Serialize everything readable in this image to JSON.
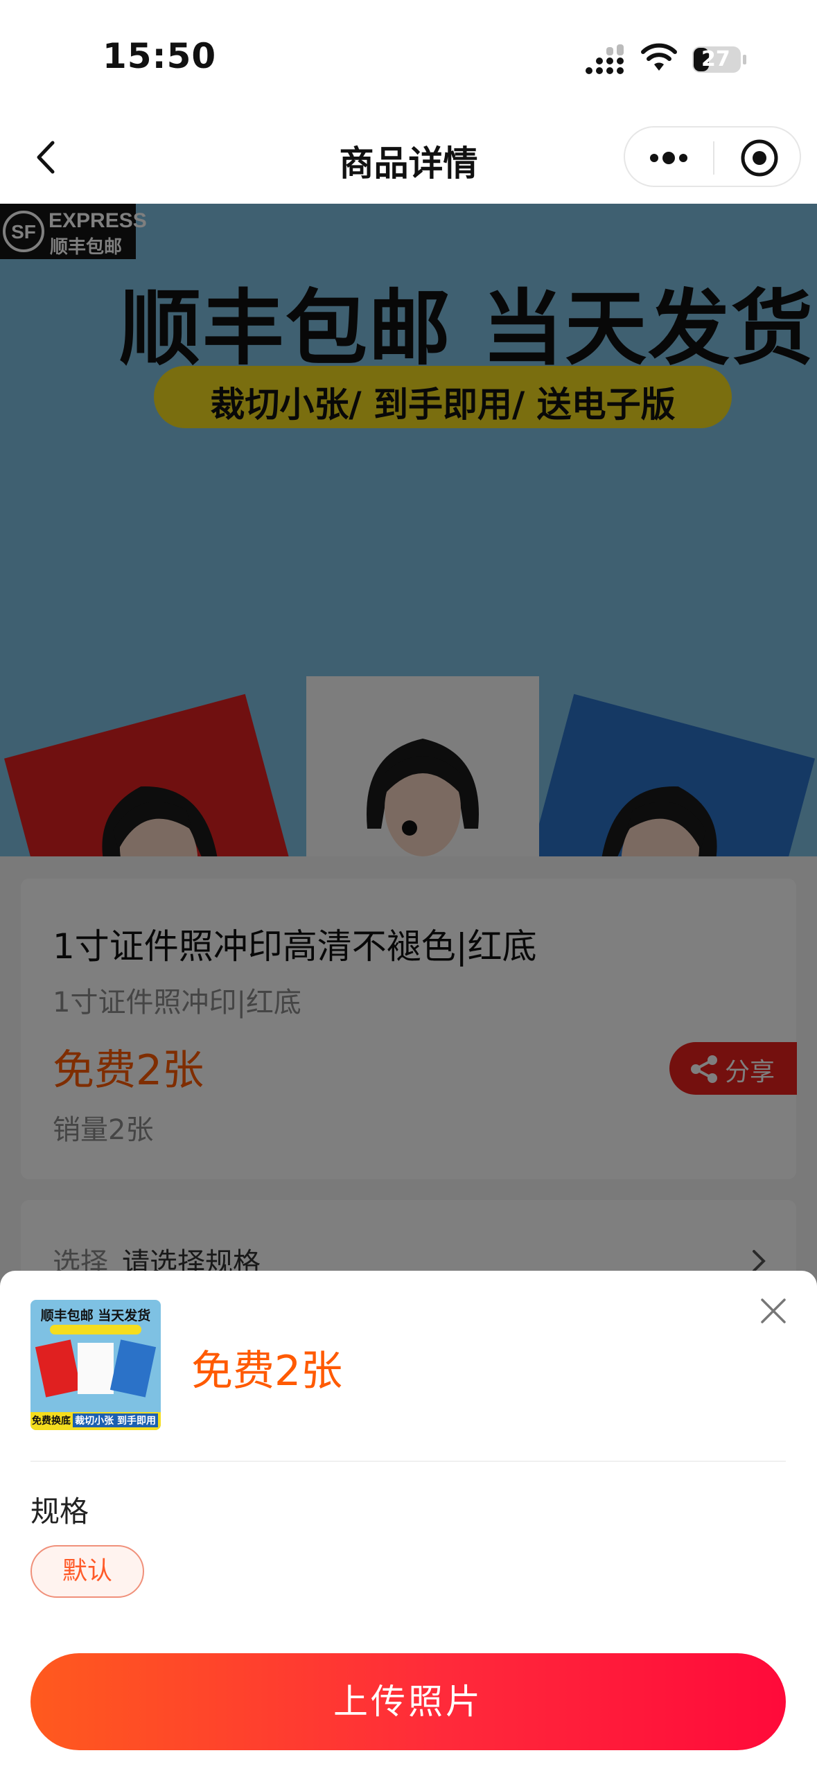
{
  "status_bar": {
    "time": "15:50",
    "battery": "27"
  },
  "nav": {
    "title": "商品详情"
  },
  "banner": {
    "badge_top": "EXPRESS",
    "badge_sub": "顺丰包邮",
    "headline": "顺丰包邮 当天发货",
    "tagline": "裁切小张/ 到手即用/ 送电子版"
  },
  "product": {
    "title": "1寸证件照冲印高清不褪色|红底",
    "subtitle": "1寸证件照冲印|红底",
    "price": "免费2张",
    "sales": "销量2张",
    "share_label": "分享"
  },
  "spec_row": {
    "label": "选择",
    "value": "请选择规格"
  },
  "sheet": {
    "price": "免费2张",
    "thumb_title": "顺丰包邮 当天发货",
    "thumb_left_tag": "免费换底",
    "thumb_right_tag": "裁切小张 到手即用",
    "spec_heading": "规格",
    "options": [
      "默认"
    ],
    "upload_label": "上传照片"
  },
  "colors": {
    "accent": "#ff5a00",
    "button_start": "#ff5a1e",
    "button_end": "#ff0a3a",
    "share_bg": "#e8201c",
    "banner_bg": "#7ec1e3"
  }
}
